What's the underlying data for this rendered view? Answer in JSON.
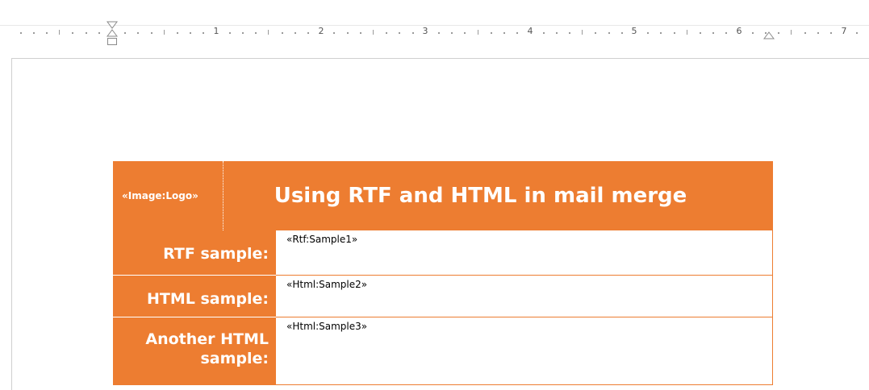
{
  "ruler": {
    "numbers": [
      "1",
      "2",
      "3",
      "4",
      "5",
      "6",
      "7"
    ]
  },
  "table": {
    "logo_field": "«Image:Logo»",
    "title": "Using RTF and HTML in mail merge",
    "rows": [
      {
        "label": "RTF sample:",
        "field": "«Rtf:Sample1»"
      },
      {
        "label": "HTML sample:",
        "field": "«Html:Sample2»"
      },
      {
        "label": "Another HTML sample:",
        "field": "«Html:Sample3»"
      }
    ]
  },
  "colors": {
    "accent": "#ED7D31",
    "header_text": "#FFFFFF",
    "body_text": "#000000"
  }
}
